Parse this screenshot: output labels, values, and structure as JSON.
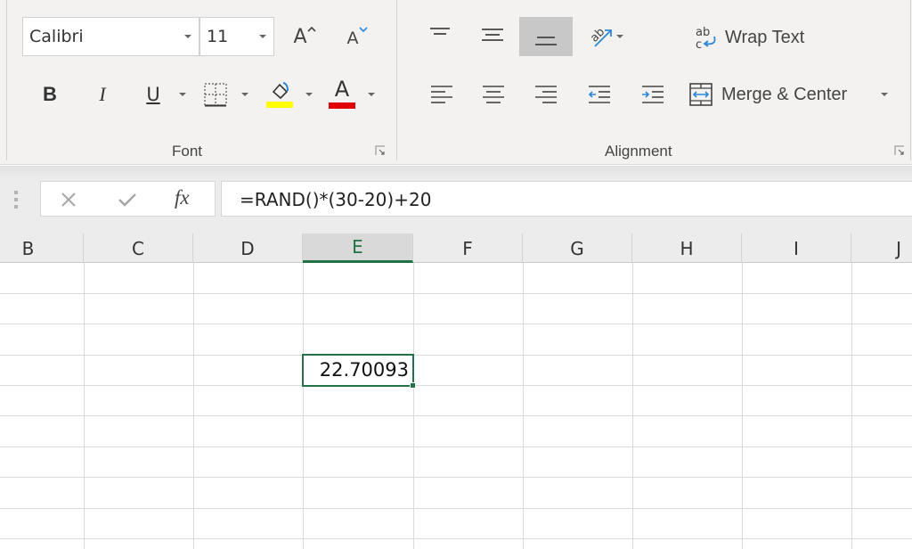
{
  "ribbon": {
    "font_group": {
      "label": "Font",
      "font_name": "Calibri",
      "font_size": "11",
      "increase_font_label": "A",
      "decrease_font_label": "A",
      "bold_label": "B",
      "italic_label": "I",
      "underline_label": "U",
      "font_color_label": "A",
      "highlight_color": "#ffff00",
      "font_color": "#e00000"
    },
    "alignment_group": {
      "label": "Alignment",
      "wrap_text_label": "Wrap Text",
      "merge_center_label": "Merge & Center",
      "active_button": "bottom-align"
    }
  },
  "formula_bar": {
    "cancel_icon": "close-icon",
    "enter_icon": "check-icon",
    "fx_label": "fx",
    "formula": "=RAND()*(30-20)+20"
  },
  "columns": [
    "B",
    "C",
    "D",
    "E",
    "F",
    "G",
    "H",
    "I",
    "J"
  ],
  "active_column": "E",
  "active_cell": {
    "column": "E",
    "value": "22.70093"
  },
  "colors": {
    "accent": "#217346",
    "ribbon_bg": "#f3f2f1",
    "icon_blue": "#2b88d8"
  }
}
